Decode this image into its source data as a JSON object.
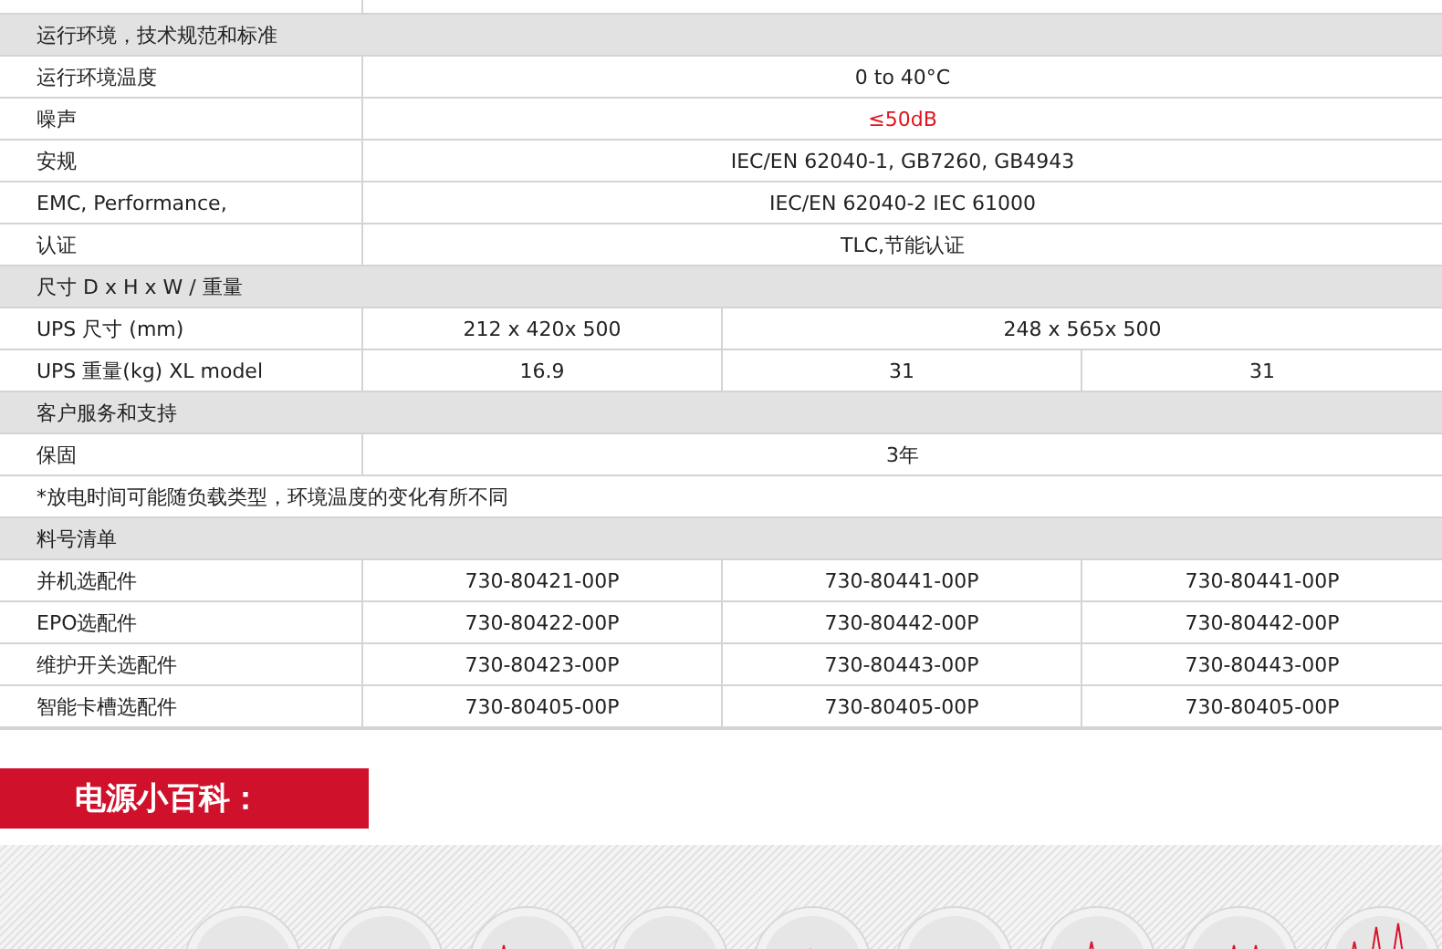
{
  "table": {
    "rows": [
      {
        "kind": "cut"
      },
      {
        "kind": "section",
        "label": "运行环境，技术规范和标准"
      },
      {
        "kind": "full",
        "label": "运行环境温度",
        "value": "0 to 40°C",
        "highlight": false
      },
      {
        "kind": "full",
        "label": "噪声",
        "value": "≤50dB",
        "highlight": true
      },
      {
        "kind": "full",
        "label": "安规",
        "value": "IEC/EN 62040-1, GB7260, GB4943",
        "highlight": false
      },
      {
        "kind": "full",
        "label": "EMC, Performance,",
        "value": "IEC/EN 62040-2  IEC 61000",
        "highlight": false
      },
      {
        "kind": "full",
        "label": "认证",
        "value": "TLC,节能认证",
        "highlight": false
      },
      {
        "kind": "section",
        "label": "尺寸 D x H x W / 重量"
      },
      {
        "kind": "split",
        "label": "UPS 尺寸 (mm)",
        "cells": [
          {
            "kind": "one",
            "text": "212 x 420x 500"
          },
          {
            "kind": "two",
            "text": "248 x 565x 500"
          }
        ]
      },
      {
        "kind": "split",
        "label": "UPS 重量(kg) XL model",
        "cells": [
          {
            "kind": "one",
            "text": "16.9"
          },
          {
            "kind": "one",
            "text": "31"
          },
          {
            "kind": "one",
            "text": "31"
          }
        ]
      },
      {
        "kind": "section",
        "label": "客户服务和支持"
      },
      {
        "kind": "full",
        "label": "保固",
        "value": "3年",
        "highlight": false
      },
      {
        "kind": "note",
        "label": "*放电时间可能随负载类型，环境温度的变化有所不同"
      },
      {
        "kind": "section",
        "label": "料号清单"
      },
      {
        "kind": "split",
        "label": "并机选配件",
        "cells": [
          {
            "kind": "one",
            "text": "730-80421-00P"
          },
          {
            "kind": "one",
            "text": "730-80441-00P"
          },
          {
            "kind": "one",
            "text": "730-80441-00P"
          }
        ]
      },
      {
        "kind": "split",
        "label": "EPO选配件",
        "cells": [
          {
            "kind": "one",
            "text": "730-80422-00P"
          },
          {
            "kind": "one",
            "text": "730-80442-00P"
          },
          {
            "kind": "one",
            "text": "730-80442-00P"
          }
        ]
      },
      {
        "kind": "split",
        "label": "维护开关选配件",
        "cells": [
          {
            "kind": "one",
            "text": "730-80423-00P"
          },
          {
            "kind": "one",
            "text": "730-80443-00P"
          },
          {
            "kind": "one",
            "text": "730-80443-00P"
          }
        ]
      },
      {
        "kind": "split",
        "label": "智能卡槽选配件",
        "cells": [
          {
            "kind": "one",
            "text": "730-80405-00P"
          },
          {
            "kind": "one",
            "text": "730-80405-00P"
          },
          {
            "kind": "one",
            "text": "730-80405-00P"
          }
        ]
      }
    ]
  },
  "banner": {
    "title": "电源小百科："
  }
}
